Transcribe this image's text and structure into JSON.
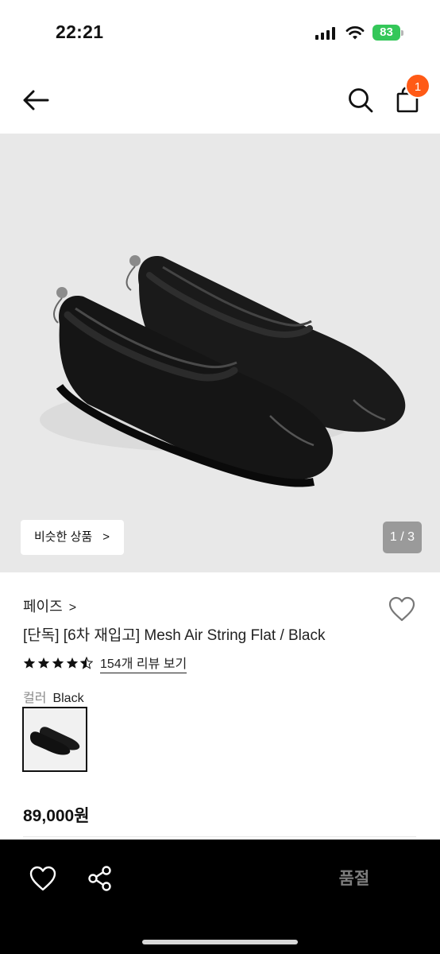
{
  "status_bar": {
    "time": "22:21",
    "battery": "83"
  },
  "header": {
    "back_icon": "arrow-left-icon",
    "search_icon": "search-icon",
    "cart_icon": "shopping-bag-icon",
    "cart_badge": "1",
    "badge_color": "#ff5a16"
  },
  "gallery": {
    "similar_products_label": "비슷한 상품",
    "page_indicator": "1 / 3"
  },
  "product": {
    "brand": "페이즈",
    "title": "[단독] [6차 재입고] Mesh Air String Flat / Black",
    "rating": 4.5,
    "review_link": "154개 리뷰 보기",
    "color_label": "컬러",
    "color_value": "Black",
    "price": "89,000원"
  },
  "bottom_bar": {
    "wishlist_icon": "heart-icon",
    "share_icon": "share-icon",
    "soldout_label": "품절",
    "background": "#000000"
  }
}
